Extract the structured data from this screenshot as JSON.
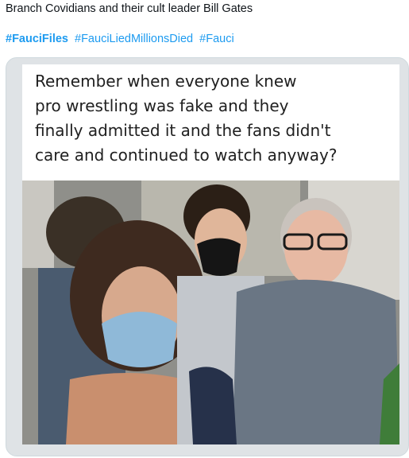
{
  "tweet": {
    "text": "Branch Covidians and their cult leader Bill Gates",
    "hashtags": [
      {
        "label": "#FauciFiles",
        "bold": true
      },
      {
        "label": "#FauciLiedMillionsDied",
        "bold": false
      },
      {
        "label": "#Fauci",
        "bold": false
      }
    ]
  },
  "meme": {
    "caption_lines": [
      "Remember when everyone knew",
      "pro wrestling was fake and they",
      "finally admitted it and the fans didn't",
      "care and continued to watch anyway?"
    ]
  },
  "colors": {
    "hashtag": "#1d9bf0",
    "text": "#0f1419",
    "card_border": "#cfd9de"
  }
}
